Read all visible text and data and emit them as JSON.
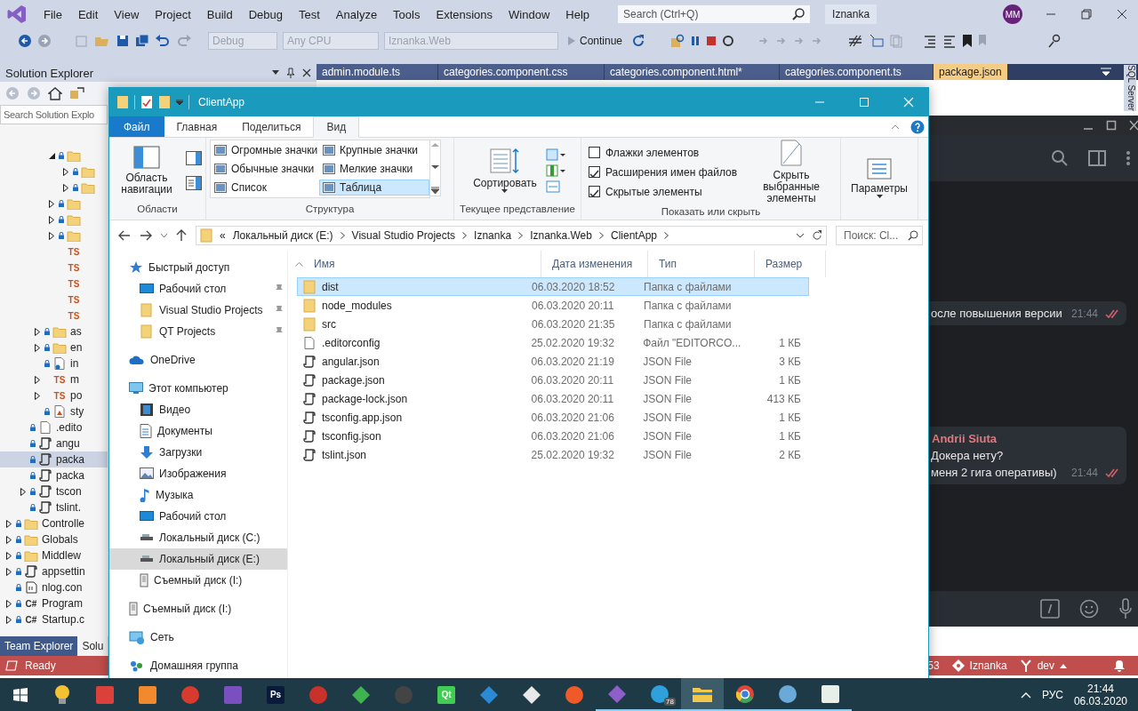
{
  "vs": {
    "menu": [
      "File",
      "Edit",
      "View",
      "Project",
      "Build",
      "Debug",
      "Test",
      "Analyze",
      "Tools",
      "Extensions",
      "Window",
      "Help"
    ],
    "search": {
      "placeholder": "Search (Ctrl+Q)"
    },
    "solution_name": "Iznanka",
    "account": "MM",
    "toolbar": {
      "dropdowns": [
        {
          "label": "Debug",
          "disabled": true
        },
        {
          "label": "Any CPU",
          "disabled": true
        },
        {
          "label": "Iznanka.Web",
          "disabled": true
        }
      ],
      "continue": "Continue"
    },
    "solution_explorer": {
      "title": "Solution Explorer",
      "search": {
        "placeholder": "Search Solution Explo"
      },
      "tree": [
        {
          "children": [
            {
              "children": [
                {
                  "children": [
                    {
                      "kind": "folder",
                      "locked": true,
                      "expanded": true,
                      "selected": false,
                      "children": [
                        {
                          "kind": "folder",
                          "locked": true,
                          "expanded": false,
                          "selected": false
                        },
                        {
                          "kind": "folder",
                          "locked": true,
                          "expanded": false,
                          "selected": false
                        }
                      ]
                    },
                    {
                      "kind": "folder",
                      "locked": true,
                      "expanded": false,
                      "selected": false
                    },
                    {
                      "kind": "folder",
                      "locked": true,
                      "expanded": false,
                      "selected": false
                    },
                    {
                      "kind": "folder",
                      "locked": true,
                      "expanded": false,
                      "selected": false
                    },
                    {
                      "kind": "ts",
                      "badge": "TS",
                      "locked": false,
                      "selected": false
                    },
                    {
                      "kind": "ts",
                      "badge": "TS",
                      "locked": false,
                      "selected": false
                    },
                    {
                      "kind": "ts",
                      "badge": "TS",
                      "locked": false,
                      "selected": false
                    },
                    {
                      "kind": "ts",
                      "badge": "TS",
                      "locked": false,
                      "selected": false
                    },
                    {
                      "kind": "ts",
                      "badge": "TS",
                      "locked": false,
                      "selected": false
                    }
                  ]
                },
                {
                  "kind": "folder",
                  "label": "as",
                  "locked": true,
                  "expanded": false,
                  "selected": false
                },
                {
                  "kind": "folder",
                  "label": "en",
                  "locked": true,
                  "expanded": false,
                  "selected": false
                },
                {
                  "kind": "html",
                  "label": "in",
                  "locked": true,
                  "selected": false
                },
                {
                  "kind": "ts",
                  "badge": "TS",
                  "label": "m",
                  "locked": false,
                  "expanded": false,
                  "selected": false
                },
                {
                  "kind": "ts",
                  "badge": "TS",
                  "label": "po",
                  "locked": false,
                  "expanded": false,
                  "selected": false
                },
                {
                  "kind": "style",
                  "label": "sty",
                  "locked": true,
                  "selected": false
                }
              ]
            },
            {
              "kind": "file",
              "label": ".edito",
              "locked": true,
              "selected": false
            },
            {
              "kind": "json",
              "label": "angu",
              "locked": true,
              "selected": false
            },
            {
              "kind": "json",
              "label": "packa",
              "locked": true,
              "selected": true
            },
            {
              "kind": "json",
              "label": "packa",
              "locked": true,
              "selected": false
            },
            {
              "kind": "json",
              "label": "tscon",
              "locked": true,
              "expanded": false,
              "selected": false
            },
            {
              "kind": "json",
              "label": "tslint.",
              "locked": true,
              "selected": false
            }
          ]
        },
        {
          "kind": "folder",
          "label": "Controlle",
          "locked": true,
          "expanded": false,
          "selected": false
        },
        {
          "kind": "folder",
          "label": "Globals",
          "locked": true,
          "expanded": false,
          "selected": false
        },
        {
          "kind": "folder",
          "label": "Middlew",
          "locked": true,
          "expanded": false,
          "selected": false
        },
        {
          "kind": "json",
          "label": "appsettin",
          "locked": true,
          "expanded": false,
          "selected": false
        },
        {
          "kind": "config",
          "label": "nlog.con",
          "locked": true,
          "selected": false
        },
        {
          "kind": "cs",
          "badge": "C#",
          "label": "Program",
          "locked": true,
          "expanded": false,
          "selected": false
        },
        {
          "kind": "cs",
          "badge": "C#",
          "label": "Startup.c",
          "locked": true,
          "expanded": false,
          "selected": false
        }
      ],
      "bottom_tabs": [
        {
          "label": "Team Explorer",
          "selected": false
        },
        {
          "label": "Solu",
          "selected": true
        }
      ]
    },
    "editor_tabs": [
      {
        "label": "admin.module.ts",
        "selected": false
      },
      {
        "label": "categories.component.css",
        "selected": false
      },
      {
        "label": "categories.component.html*",
        "selected": false
      },
      {
        "label": "categories.component.ts",
        "selected": false
      },
      {
        "label": "package.json",
        "selected": true
      }
    ],
    "side_tab": "SQL Server",
    "status_bar": {
      "state": "Ready",
      "count": "53",
      "repository": "Iznanka",
      "branch": "dev"
    }
  },
  "explorer": {
    "title": "ClientApp",
    "ribbon_tabs": [
      {
        "label": "Файл",
        "kind": "file",
        "selected": false
      },
      {
        "label": "Главная",
        "kind": "tab",
        "selected": false
      },
      {
        "label": "Поделиться",
        "kind": "tab",
        "selected": false
      },
      {
        "label": "Вид",
        "kind": "tab",
        "selected": true
      }
    ],
    "groups": {
      "panes": {
        "label": "Области",
        "button": "Область навигации"
      },
      "layout": {
        "label": "Структура",
        "options": [
          {
            "label": "Огромные значки",
            "selected": false
          },
          {
            "label": "Крупные значки",
            "selected": false
          },
          {
            "label": "Обычные значки",
            "selected": false
          },
          {
            "label": "Мелкие значки",
            "selected": false
          },
          {
            "label": "Список",
            "selected": false
          },
          {
            "label": "Таблица",
            "selected": true
          }
        ]
      },
      "current_view": {
        "label": "Текущее представление",
        "button": "Сортировать"
      },
      "show_hide": {
        "label": "Показать или скрыть",
        "checkboxes": [
          {
            "label": "Флажки элементов",
            "checked": false
          },
          {
            "label": "Расширения имен файлов",
            "checked": true
          },
          {
            "label": "Скрытые элементы",
            "checked": true
          }
        ],
        "button": "Скрыть выбранные элементы"
      },
      "options": {
        "button": "Параметры"
      }
    },
    "address": {
      "overflow": "«",
      "segments": [
        "Локальный диск (E:)",
        "Visual Studio Projects",
        "Iznanka",
        "Iznanka.Web",
        "ClientApp"
      ]
    },
    "search": {
      "placeholder": "Поиск: Cl..."
    },
    "nav": [
      {
        "label": "Быстрый доступ",
        "kind": "star",
        "selected": false,
        "children": [
          {
            "label": "Рабочий стол",
            "kind": "desktop",
            "pinned": true,
            "selected": false
          },
          {
            "label": "Visual Studio Projects",
            "kind": "folder",
            "pinned": true,
            "selected": false
          },
          {
            "label": "QT Projects",
            "kind": "folder",
            "pinned": true,
            "selected": false
          }
        ]
      },
      {
        "label": "OneDrive",
        "kind": "cloud",
        "selected": false
      },
      {
        "label": "Этот компьютер",
        "kind": "pc",
        "selected": false,
        "children": [
          {
            "label": "Видео",
            "kind": "video",
            "selected": false
          },
          {
            "label": "Документы",
            "kind": "docs",
            "selected": false
          },
          {
            "label": "Загрузки",
            "kind": "download",
            "selected": false
          },
          {
            "label": "Изображения",
            "kind": "pictures",
            "selected": false
          },
          {
            "label": "Музыка",
            "kind": "music",
            "selected": false
          },
          {
            "label": "Рабочий стол",
            "kind": "desktop",
            "selected": false
          },
          {
            "label": "Локальный диск (C:)",
            "kind": "drive",
            "selected": false
          },
          {
            "label": "Локальный диск (E:)",
            "kind": "drive",
            "selected": true
          },
          {
            "label": "Съемный диск (I:)",
            "kind": "usb",
            "selected": false
          }
        ]
      },
      {
        "label": "Съемный диск (I:)",
        "kind": "usb",
        "selected": false
      },
      {
        "label": "Сеть",
        "kind": "network",
        "selected": false
      },
      {
        "label": "Домашняя группа",
        "kind": "homegroup",
        "selected": false
      }
    ],
    "columns": [
      "Имя",
      "Дата изменения",
      "Тип",
      "Размер"
    ],
    "rows": [
      {
        "name": "dist",
        "modified": "06.03.2020 18:52",
        "type": "Папка с файлами",
        "kind": "folder",
        "selected": true
      },
      {
        "name": "node_modules",
        "modified": "06.03.2020 20:11",
        "type": "Папка с файлами",
        "kind": "folder",
        "selected": false
      },
      {
        "name": "src",
        "modified": "06.03.2020 21:35",
        "type": "Папка с файлами",
        "kind": "folder",
        "selected": false
      },
      {
        "name": ".editorconfig",
        "modified": "25.02.2020 19:32",
        "type": "Файл \"EDITORCO...",
        "size": "1 КБ",
        "kind": "file",
        "selected": false
      },
      {
        "name": "angular.json",
        "modified": "06.03.2020 21:19",
        "type": "JSON File",
        "size": "3 КБ",
        "kind": "json",
        "selected": false
      },
      {
        "name": "package.json",
        "modified": "06.03.2020 20:11",
        "type": "JSON File",
        "size": "1 КБ",
        "kind": "json",
        "selected": false
      },
      {
        "name": "package-lock.json",
        "modified": "06.03.2020 20:11",
        "type": "JSON File",
        "size": "413 КБ",
        "kind": "json",
        "selected": false
      },
      {
        "name": "tsconfig.app.json",
        "modified": "06.03.2020 21:06",
        "type": "JSON File",
        "size": "1 КБ",
        "kind": "json",
        "selected": false
      },
      {
        "name": "tsconfig.json",
        "modified": "06.03.2020 21:06",
        "type": "JSON File",
        "size": "1 КБ",
        "kind": "json",
        "selected": false
      },
      {
        "name": "tslint.json",
        "modified": "25.02.2020 19:32",
        "type": "JSON File",
        "size": "2 КБ",
        "kind": "json",
        "selected": false
      }
    ]
  },
  "telegram": {
    "messages": [
      {
        "lines": [
          "осле повышения версии"
        ],
        "time": "21:44",
        "read": true
      },
      {
        "sender": "Andrii Siuta",
        "lines": [
          "Докера нету?",
          "меня 2 гига оперативы)"
        ],
        "time": "21:44",
        "read": true
      }
    ]
  },
  "taskbar": {
    "apps": [
      {
        "kind": "bulb",
        "color": "#f2c230",
        "running": false,
        "selected": false
      },
      {
        "kind": "tile",
        "color": "#d9413a",
        "running": false,
        "selected": false
      },
      {
        "kind": "tile",
        "color": "#f08a2c",
        "running": false,
        "selected": false
      },
      {
        "kind": "circle",
        "color": "#d93a2e",
        "running": false,
        "selected": false
      },
      {
        "kind": "tile",
        "color": "#7a4fc0",
        "running": false,
        "selected": false
      },
      {
        "kind": "tile",
        "color": "#0a1a3a",
        "label": "Ps",
        "running": false,
        "selected": false
      },
      {
        "kind": "circle",
        "color": "#c8322a",
        "running": false,
        "selected": false
      },
      {
        "kind": "diamond",
        "color": "#3fb34f",
        "running": false,
        "selected": false
      },
      {
        "kind": "circle",
        "color": "#444444",
        "running": false,
        "selected": false
      },
      {
        "kind": "tile",
        "color": "#41cd52",
        "label": "Qt",
        "running": false,
        "selected": false
      },
      {
        "kind": "diamond",
        "color": "#2a8ad4",
        "running": false,
        "selected": false
      },
      {
        "kind": "diamond",
        "color": "#e8e8e8",
        "running": false,
        "selected": false
      },
      {
        "kind": "circle",
        "color": "#f05a28",
        "running": false,
        "selected": false
      },
      {
        "kind": "diamond",
        "color": "#8e5fc9",
        "running": true,
        "selected": false
      },
      {
        "kind": "circle",
        "color": "#2ea0db",
        "badge": "78",
        "running": true,
        "selected": false
      },
      {
        "kind": "folder",
        "color": "#f3c74a",
        "running": true,
        "selected": true
      },
      {
        "kind": "ring",
        "color": "#e0463a",
        "running": true,
        "selected": false
      },
      {
        "kind": "circle",
        "color": "#6aa9d8",
        "running": true,
        "selected": false
      },
      {
        "kind": "tile",
        "color": "#e8efe8",
        "running": true,
        "selected": false
      }
    ],
    "language": "РУС",
    "time": "21:44",
    "date": "06.03.2020"
  }
}
